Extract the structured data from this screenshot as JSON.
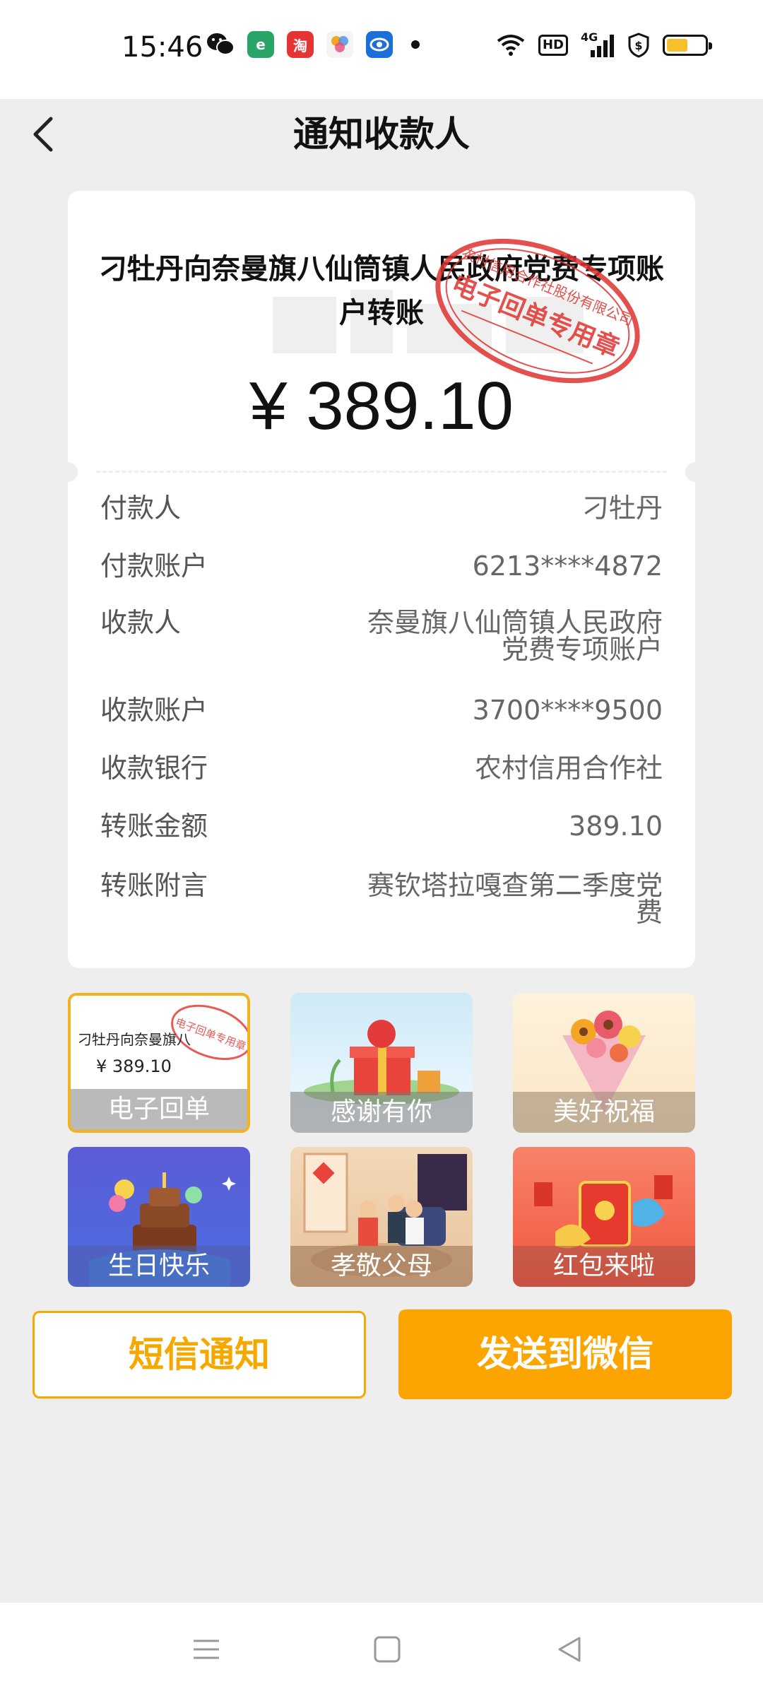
{
  "status_bar": {
    "time": "15:46",
    "network": "4G",
    "hd": "HD"
  },
  "header": {
    "title": "通知收款人"
  },
  "receipt": {
    "title": "刁牡丹向奈曼旗八仙筒镇人民政府党费专项账户转账",
    "amount": "¥ 389.10",
    "stamp_top": "农村信用合作社股份有限公司",
    "stamp_main": "电子回单专用章",
    "details": [
      {
        "label": "付款人",
        "value": "刁牡丹"
      },
      {
        "label": "付款账户",
        "value": "6213****4872"
      },
      {
        "label": "收款人",
        "value": "奈曼旗八仙筒镇人民政府党费专项账户"
      },
      {
        "label": "收款账户",
        "value": "3700****9500"
      },
      {
        "label": "收款银行",
        "value": "农村信用合作社"
      },
      {
        "label": "转账金额",
        "value": "389.10"
      },
      {
        "label": "转账附言",
        "value": "赛钦塔拉嘎查第二季度党费"
      }
    ]
  },
  "templates": [
    {
      "label": "电子回单",
      "mini_title": "刁牡丹向奈曼旗八",
      "mini_amount": "¥ 389.10",
      "selected": true
    },
    {
      "label": "感谢有你"
    },
    {
      "label": "美好祝福"
    },
    {
      "label": "生日快乐"
    },
    {
      "label": "孝敬父母"
    },
    {
      "label": "红包来啦"
    }
  ],
  "buttons": {
    "sms": "短信通知",
    "wechat": "发送到微信"
  },
  "colors": {
    "accent": "#fca500",
    "stamp_red": "#e0322e",
    "background": "#eeeeee"
  }
}
